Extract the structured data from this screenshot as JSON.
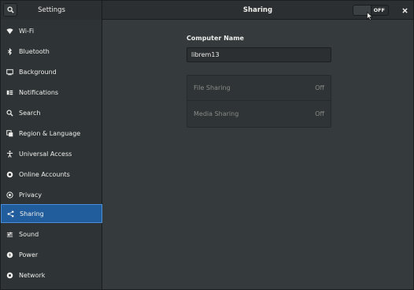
{
  "window": {
    "sidebar_title": "Settings",
    "page_title": "Sharing",
    "switch_state": "OFF"
  },
  "sidebar": {
    "items": [
      {
        "label": "Wi-Fi",
        "icon": "wifi-icon"
      },
      {
        "label": "Bluetooth",
        "icon": "bluetooth-icon"
      },
      {
        "label": "Background",
        "icon": "background-icon"
      },
      {
        "label": "Notifications",
        "icon": "notifications-icon"
      },
      {
        "label": "Search",
        "icon": "search-icon"
      },
      {
        "label": "Region & Language",
        "icon": "region-icon"
      },
      {
        "label": "Universal Access",
        "icon": "universal-access-icon"
      },
      {
        "label": "Online Accounts",
        "icon": "online-accounts-icon"
      },
      {
        "label": "Privacy",
        "icon": "privacy-icon"
      },
      {
        "label": "Sharing",
        "icon": "sharing-icon"
      },
      {
        "label": "Sound",
        "icon": "sound-icon"
      },
      {
        "label": "Power",
        "icon": "power-icon"
      },
      {
        "label": "Network",
        "icon": "network-icon"
      }
    ],
    "active": "Sharing"
  },
  "main": {
    "computer_name_label": "Computer Name",
    "computer_name_value": "librem13",
    "rows": [
      {
        "label": "File Sharing",
        "value": "Off"
      },
      {
        "label": "Media Sharing",
        "value": "Off"
      }
    ]
  },
  "colors": {
    "accent": "#215d9c",
    "window_bg": "#353a3c",
    "sidebar_bg": "#2e3335"
  }
}
